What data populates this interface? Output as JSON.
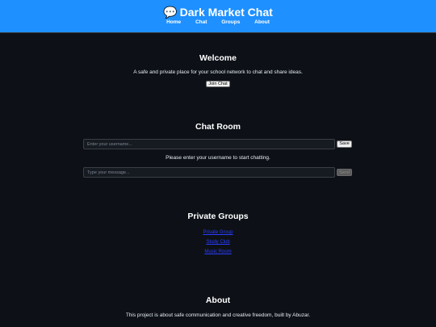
{
  "header": {
    "brand_icon": "💬",
    "brand_icon_name": "speech-bubble-icon",
    "title": "Dark Market Chat",
    "nav": [
      "Home",
      "Chat",
      "Groups",
      "About"
    ],
    "background_color": "#1e90ff"
  },
  "welcome": {
    "title": "Welcome",
    "text": "A safe and private place for your school network to chat and share ideas.",
    "button_label": "Join Chat"
  },
  "chat": {
    "title": "Chat Room",
    "username_placeholder": "Enter your username...",
    "save_label": "Save",
    "status": "Please enter your username to start chatting.",
    "message_placeholder": "Type your message...",
    "send_label": "Send"
  },
  "groups": {
    "title": "Private Groups",
    "items": [
      "Private Group",
      "Study Club",
      "Music Room"
    ],
    "link_color": "#2a3cff"
  },
  "about": {
    "title": "About",
    "text": "This project is about safe communication and creative freedom, built by Abuzar."
  }
}
